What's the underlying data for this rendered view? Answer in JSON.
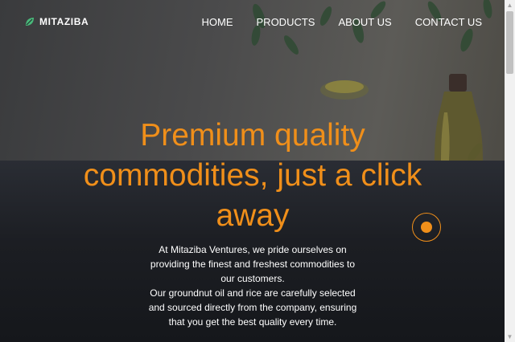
{
  "brand": {
    "name": "MITAZIBA",
    "icon": "leaf-icon",
    "icon_color": "#49b87a"
  },
  "nav": {
    "items": [
      {
        "label": "HOME"
      },
      {
        "label": "PRODUCTS"
      },
      {
        "label": "ABOUT US"
      },
      {
        "label": "CONTACT US"
      }
    ]
  },
  "hero": {
    "headline": "Premium quality commodities, just a click away",
    "paragraph_1": "At Mitaziba Ventures, we pride ourselves on providing the finest and freshest commodities to our customers.",
    "paragraph_2": "Our groundnut oil and rice are carefully selected and sourced directly from the company, ensuring that you get the best quality every time."
  },
  "scrollbar": {
    "up_icon": "arrow-up-icon",
    "down_icon": "arrow-down-icon"
  },
  "colors": {
    "accent": "#f08f1a",
    "text": "#ffffff",
    "background": "#1d1f24"
  }
}
